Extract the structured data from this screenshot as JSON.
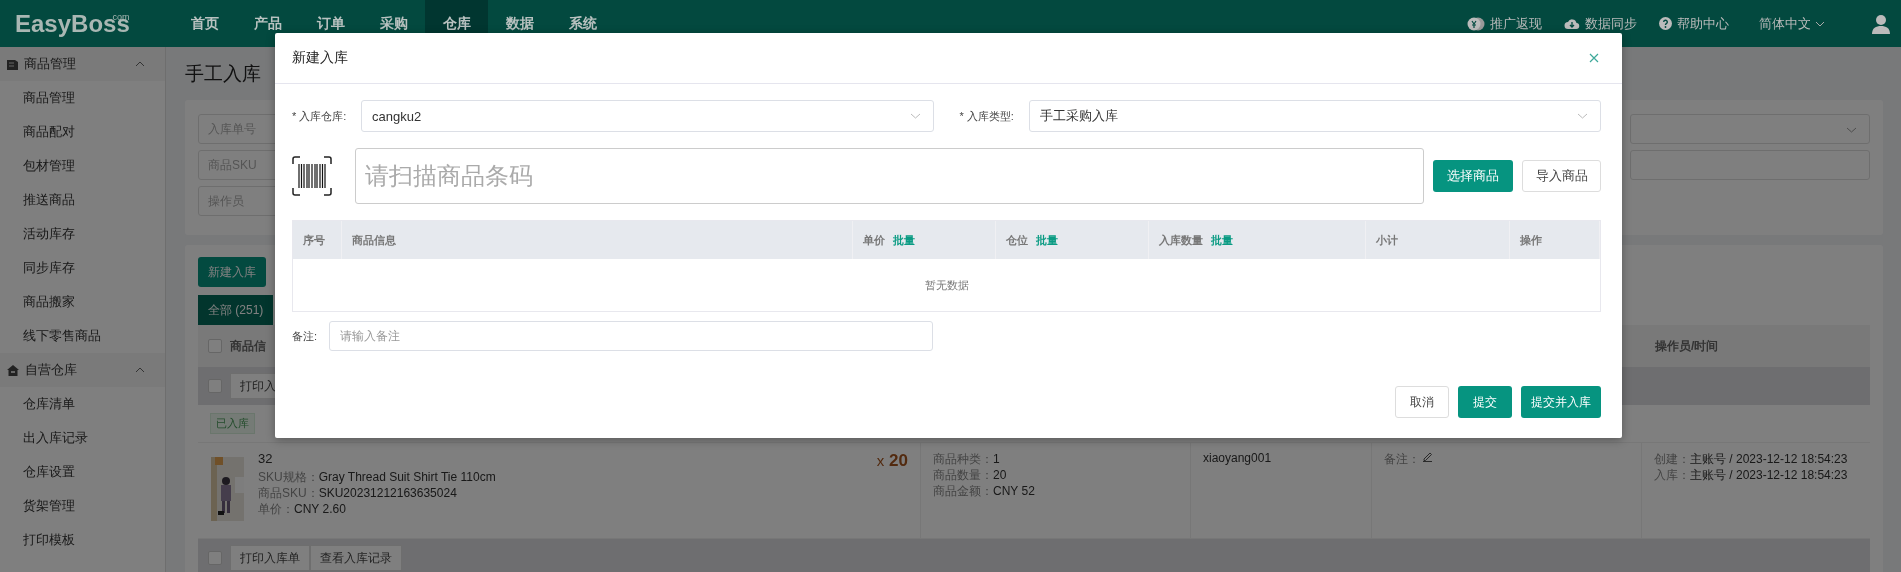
{
  "top_nav": {
    "logo": "EasyBoss",
    "logo_suffix": ".com",
    "menu": [
      {
        "label": "首页",
        "selected": false
      },
      {
        "label": "产品",
        "selected": false
      },
      {
        "label": "订单",
        "selected": false
      },
      {
        "label": "采购",
        "selected": false
      },
      {
        "label": "仓库",
        "selected": true
      },
      {
        "label": "数据",
        "selected": false
      },
      {
        "label": "系统",
        "selected": false
      }
    ],
    "links": [
      "推广返现",
      "数据同步",
      "帮助中心"
    ],
    "language": "简体中文"
  },
  "sidebar": {
    "groups": [
      {
        "title": "商品管理",
        "expanded": true,
        "items": [
          "商品管理",
          "商品配对",
          "包材管理",
          "推送商品",
          "活动库存",
          "同步库存",
          "商品搬家",
          "线下零售商品"
        ]
      },
      {
        "title": "自营仓库",
        "expanded": true,
        "items": [
          "仓库清单",
          "出入库记录",
          "仓库设置",
          "货架管理",
          "打印模板"
        ]
      }
    ]
  },
  "page": {
    "title": "手工入库",
    "filters": {
      "order_no_placeholder": "入库单号",
      "search_type": "商品SKU",
      "operator_placeholder": "操作员"
    },
    "new_button": "新建入库",
    "tab": {
      "label": "全部 (251)",
      "selected": true
    },
    "columns": [
      "商品信",
      "操作员/时间"
    ],
    "header_checkbox": {
      "checked": false
    },
    "groups": [
      {
        "checked": false,
        "buttons": [
          "打印入"
        ],
        "status": "已入库",
        "item": {
          "name": "32",
          "details": [
            {
              "label": "SKU规格：",
              "value": "Gray Thread Suit Shirt Tie 110cm"
            },
            {
              "label": "商品SKU：",
              "value": "SKU20231212163635024"
            },
            {
              "label": "单价：",
              "value": "CNY 2.60"
            }
          ],
          "qty_prefix": "x",
          "qty": "20",
          "summary": [
            {
              "label": "商品种类：",
              "value": "1"
            },
            {
              "label": "商品数量：",
              "value": "20"
            },
            {
              "label": "商品金额：",
              "value": "CNY 52"
            }
          ],
          "operator": "xiaoyang001",
          "remark_label": "备注：",
          "times": [
            {
              "label": "创建：",
              "value": "主账号 / 2023-12-12 18:54:23"
            },
            {
              "label": "入库：",
              "value": "主账号 / 2023-12-12 18:54:23"
            }
          ]
        }
      },
      {
        "checked": false,
        "buttons": [
          "打印入库单",
          "查看入库记录"
        ]
      }
    ]
  },
  "modal": {
    "title": "新建入库",
    "warehouse": {
      "label": "* 入库仓库:",
      "value": "cangku2"
    },
    "type": {
      "label": "* 入库类型:",
      "value": "手工采购入库"
    },
    "scan_placeholder": "请扫描商品条码",
    "select_button": "选择商品",
    "import_button": "导入商品",
    "columns": [
      {
        "label": "序号"
      },
      {
        "label": "商品信息"
      },
      {
        "label": "单价",
        "link": "批量"
      },
      {
        "label": "仓位",
        "link": "批量"
      },
      {
        "label": "入库数量",
        "link": "批量"
      },
      {
        "label": "小计"
      },
      {
        "label": "操作"
      }
    ],
    "empty_text": "暂无数据",
    "remark": {
      "label": "备注:",
      "placeholder": "请输入备注"
    },
    "buttons": [
      {
        "label": "取消",
        "kind": "secondary"
      },
      {
        "label": "提交",
        "kind": "primary"
      },
      {
        "label": "提交并入库",
        "kind": "primary"
      }
    ]
  }
}
